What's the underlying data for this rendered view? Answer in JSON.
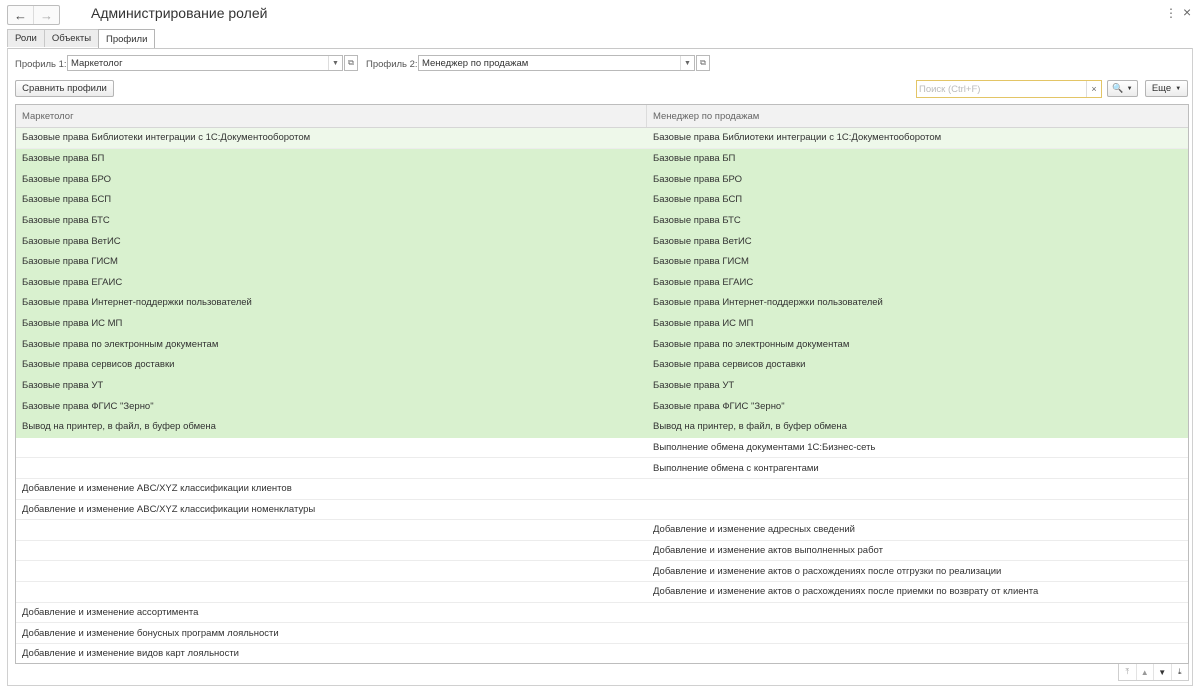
{
  "window": {
    "title": "Администрирование ролей",
    "back_icon": "←",
    "forward_icon": "→",
    "menu_icon": "⋮",
    "close_icon": "×"
  },
  "tabs": [
    {
      "label": "Роли"
    },
    {
      "label": "Объекты"
    },
    {
      "label": "Профили",
      "active": true
    }
  ],
  "filters": {
    "profile1_label": "Профиль 1:",
    "profile1_value": "Маркетолог",
    "profile2_label": "Профиль 2:",
    "profile2_value": "Менеджер по продажам"
  },
  "toolbar": {
    "compare_label": "Сравнить профили",
    "search_placeholder": "Поиск (Ctrl+F)",
    "search_icon": "🔍",
    "more_label": "Еще"
  },
  "table": {
    "columns": [
      "Маркетолог",
      "Менеджер по продажам"
    ],
    "rows": [
      {
        "c1": "Базовые права Библиотеки интеграции с 1С:Документооборотом",
        "c2": "Базовые права Библиотеки интеграции с 1С:Документооборотом",
        "style": "first"
      },
      {
        "c1": "Базовые права БП",
        "c2": "Базовые права БП",
        "style": "both"
      },
      {
        "c1": "Базовые права БРО",
        "c2": "Базовые права БРО",
        "style": "both"
      },
      {
        "c1": "Базовые права БСП",
        "c2": "Базовые права БСП",
        "style": "both"
      },
      {
        "c1": "Базовые права БТС",
        "c2": "Базовые права БТС",
        "style": "both"
      },
      {
        "c1": "Базовые права ВетИС",
        "c2": "Базовые права ВетИС",
        "style": "both"
      },
      {
        "c1": "Базовые права ГИСМ",
        "c2": "Базовые права ГИСМ",
        "style": "both"
      },
      {
        "c1": "Базовые права ЕГАИС",
        "c2": "Базовые права ЕГАИС",
        "style": "both"
      },
      {
        "c1": "Базовые права Интернет-поддержки пользователей",
        "c2": "Базовые права Интернет-поддержки пользователей",
        "style": "both"
      },
      {
        "c1": "Базовые права ИС МП",
        "c2": "Базовые права ИС МП",
        "style": "both"
      },
      {
        "c1": "Базовые права по электронным документам",
        "c2": "Базовые права по электронным документам",
        "style": "both"
      },
      {
        "c1": "Базовые права сервисов доставки",
        "c2": "Базовые права сервисов доставки",
        "style": "both"
      },
      {
        "c1": "Базовые права УТ",
        "c2": "Базовые права УТ",
        "style": "both"
      },
      {
        "c1": "Базовые права ФГИС \"Зерно\"",
        "c2": "Базовые права ФГИС \"Зерно\"",
        "style": "both"
      },
      {
        "c1": "Вывод на принтер, в файл, в буфер обмена",
        "c2": "Вывод на принтер, в файл, в буфер обмена",
        "style": "both"
      },
      {
        "c1": "",
        "c2": "Выполнение обмена документами 1С:Бизнес-сеть",
        "style": ""
      },
      {
        "c1": "",
        "c2": "Выполнение обмена с контрагентами",
        "style": ""
      },
      {
        "c1": "Добавление и изменение ABC/XYZ классификации клиентов",
        "c2": "",
        "style": ""
      },
      {
        "c1": "Добавление и изменение ABC/XYZ классификации номенклатуры",
        "c2": "",
        "style": ""
      },
      {
        "c1": "",
        "c2": "Добавление и изменение адресных сведений",
        "style": ""
      },
      {
        "c1": "",
        "c2": "Добавление и изменение актов выполненных работ",
        "style": ""
      },
      {
        "c1": "",
        "c2": "Добавление и изменение актов о расхождениях после отгрузки по реализации",
        "style": ""
      },
      {
        "c1": "",
        "c2": "Добавление и изменение актов о расхождениях после приемки по возврату от клиента",
        "style": ""
      },
      {
        "c1": "Добавление и изменение ассортимента",
        "c2": "",
        "style": ""
      },
      {
        "c1": "Добавление и изменение бонусных программ лояльности",
        "c2": "",
        "style": ""
      },
      {
        "c1": "Добавление и изменение видов карт лояльности",
        "c2": "",
        "style": ""
      }
    ]
  },
  "nav_controls": [
    "⤒",
    "▲",
    "▼",
    "⤓"
  ]
}
